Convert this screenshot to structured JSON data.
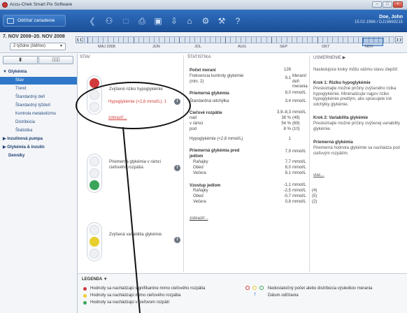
{
  "window": {
    "title": "Accu-Chek Smart Pix Software",
    "controls": [
      "–",
      "□",
      "×"
    ]
  },
  "toolbar": {
    "read_device_label": "Odčítať zariadenie",
    "icons": [
      "back-arrow-icon",
      "people-icon",
      "document-icon",
      "print-icon",
      "save-icon",
      "export-icon",
      "home-icon",
      "settings-icon",
      "tools-icon",
      "help-icon"
    ]
  },
  "patient": {
    "name": "Doe, John",
    "details": "15.02.1966 / DJ19669215"
  },
  "date": {
    "range": "7. NOV 2008–20. NOV 2008",
    "period_select": "2 týždne (štdňov)"
  },
  "timeline": {
    "months": [
      "MÁJ 2008",
      "JÚN",
      "JÚL",
      "AUG",
      "SEP",
      "OKT",
      "NOV"
    ]
  },
  "nav": {
    "items": [
      {
        "label": "Glykémia",
        "type": "head",
        "expanded": true
      },
      {
        "label": "Stav",
        "type": "sub",
        "selected": true
      },
      {
        "label": "Trend",
        "type": "sub"
      },
      {
        "label": "Štandardný deň",
        "type": "sub"
      },
      {
        "label": "Štandardný týždeň",
        "type": "sub"
      },
      {
        "label": "Kontrola metabolizmu",
        "type": "sub"
      },
      {
        "label": "Distribúcia",
        "type": "sub"
      },
      {
        "label": "Štatistika",
        "type": "sub"
      },
      {
        "label": "Inzulínová pumpa",
        "type": "head",
        "expanded": false
      },
      {
        "label": "Glykémia & inzulín",
        "type": "head",
        "expanded": false
      },
      {
        "label": "Denníky",
        "type": "head",
        "expanded": false
      }
    ]
  },
  "status": {
    "header": "STAV",
    "rows": [
      {
        "title": "Zvýšené riziko hypoglykémie",
        "lit": "red",
        "alert": "Hypoglykémie (<2,8 mmol/L): 1",
        "link": "zobraziť..."
      },
      {
        "title": "Priemerná glykémia v rámci cieľového rozpätia",
        "lit": "green"
      },
      {
        "title": "Zvýšená variabilita glykémie",
        "lit": "yellow"
      }
    ]
  },
  "stats": {
    "header": "ŠTATISTIKA",
    "count_label": "Počet meraní",
    "count_value": "128",
    "freq_label": "Frekvencia kontroly glykémie (min. 2)",
    "freq_value": "9,1",
    "freq_unit": "Meraní/ deň merania",
    "mean_label": "Priemerná glykémia",
    "mean_value": "8,0",
    "mean_unit": "mmol/L",
    "sd_label": "Štandardná odchýlka",
    "sd_value": "3,4",
    "sd_unit": "mmol/L",
    "target_label": "Cieľové rozpätie",
    "target_value": "3,9–8,3",
    "target_unit": "mmol/L",
    "target_rows": [
      {
        "label": "nad",
        "value": "38 %",
        "count": "(49)"
      },
      {
        "label": "v rámci",
        "value": "54 %",
        "count": "(69)"
      },
      {
        "label": "pod",
        "value": "8 %",
        "count": "(10)"
      }
    ],
    "hypo_label": "Hypoglykémie (<2,8 mmol/L)",
    "hypo_value": "1",
    "premeal_label": "Priemerná glykémia pred jedlom",
    "premeal_rows": [
      {
        "label": "",
        "value": "7,9",
        "unit": "mmol/L"
      },
      {
        "label": "Raňajky",
        "value": "7,7",
        "unit": "mmol/L"
      },
      {
        "label": "Obed",
        "value": "8,0",
        "unit": "mmol/L"
      },
      {
        "label": "Večera",
        "value": "8,1",
        "unit": "mmol/L"
      }
    ],
    "rise_label": "Vzostup jedlom",
    "rise_rows": [
      {
        "label": "",
        "value": "-1,1",
        "unit": "mmol/L",
        "count": "",
        "red": true
      },
      {
        "label": "Raňajky",
        "value": "-2,5",
        "unit": "mmol/L",
        "count": "(4)",
        "red": true
      },
      {
        "label": "Obed",
        "value": "-0,7",
        "unit": "mmol/L",
        "count": "(5)",
        "red": true
      },
      {
        "label": "Večera",
        "value": "0,8",
        "unit": "mmol/L",
        "count": "(2)",
        "red": false
      }
    ],
    "link": "zobraziť..."
  },
  "recommendations": {
    "header": "USMERNENIE",
    "intro": "Nasledujúce kroky môžu vášmu stavu zlepšiť:",
    "step1_title": "Krok 1: Riziko hypoglykémie",
    "step1_text": "Preskúmajte možné príčiny zvýšeného rizika hypoglykémie. Minimalizujte najprv riziko hypoglykémie predtým, ako spracujete iné odchýlky glykémie.",
    "step2_title": "Krok 2: Variabilita glykémie",
    "step2_text": "Preskúmajte možné príčiny zvýšenej variability glykémie.",
    "mean_title": "Priemerná glykémia",
    "mean_text": "Priemerná hodnota glykémie sa nachádza pod cieľovým rozpätím.",
    "more": "viac..."
  },
  "legend": {
    "title": "LEGENDA",
    "items": [
      {
        "color": "#d23b3b",
        "text": "Hodnoty sa nachádzajú signifikantne mimo cieľového rozpätia"
      },
      {
        "color": "#e8cf2e",
        "text": "Hodnoty sa nachádzajú mimo cieľového rozpätia"
      },
      {
        "color": "#3aa55a",
        "text": "Hodnoty sa nachádzajú v cieľovom rozpätí"
      }
    ],
    "right_items": [
      {
        "text": "Nedostatočný počet alebo distribúcia výsledkov merania"
      },
      {
        "text": "Dátum odčítania"
      }
    ]
  },
  "colors": {
    "red": "#d23b3b",
    "yellow": "#e8cf2e",
    "green": "#3aa55a",
    "accent": "#2f78c9"
  }
}
